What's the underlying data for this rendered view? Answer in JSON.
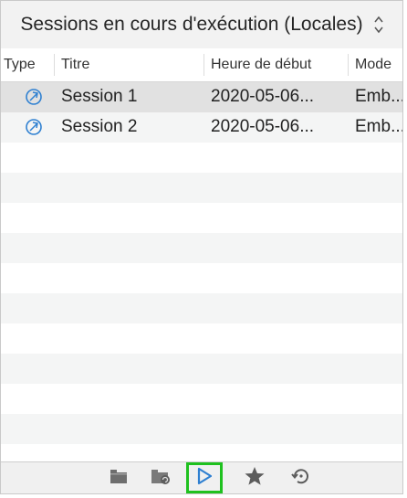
{
  "header": {
    "title": "Sessions en cours d'exécution (Locales)"
  },
  "columns": [
    {
      "label": "Type"
    },
    {
      "label": "Titre"
    },
    {
      "label": "Heure de début"
    },
    {
      "label": "Mode"
    }
  ],
  "sessions": [
    {
      "type_icon": "session-icon",
      "title": "Session 1",
      "start": "2020-05-06...",
      "mode": "Emb..."
    },
    {
      "type_icon": "session-icon",
      "title": "Session 2",
      "start": "2020-05-06...",
      "mode": "Emb..."
    }
  ],
  "toolbar": {
    "buttons": [
      {
        "icon": "folder-icon"
      },
      {
        "icon": "folder-sync-icon"
      },
      {
        "icon": "play-icon",
        "selected": true
      },
      {
        "icon": "star-icon"
      },
      {
        "icon": "history-icon"
      }
    ]
  },
  "colors": {
    "selected_row": "#e1e1e1",
    "alt_row": "#f4f5f5",
    "accent": "#2f80d1",
    "highlight": "#1fc11f"
  }
}
